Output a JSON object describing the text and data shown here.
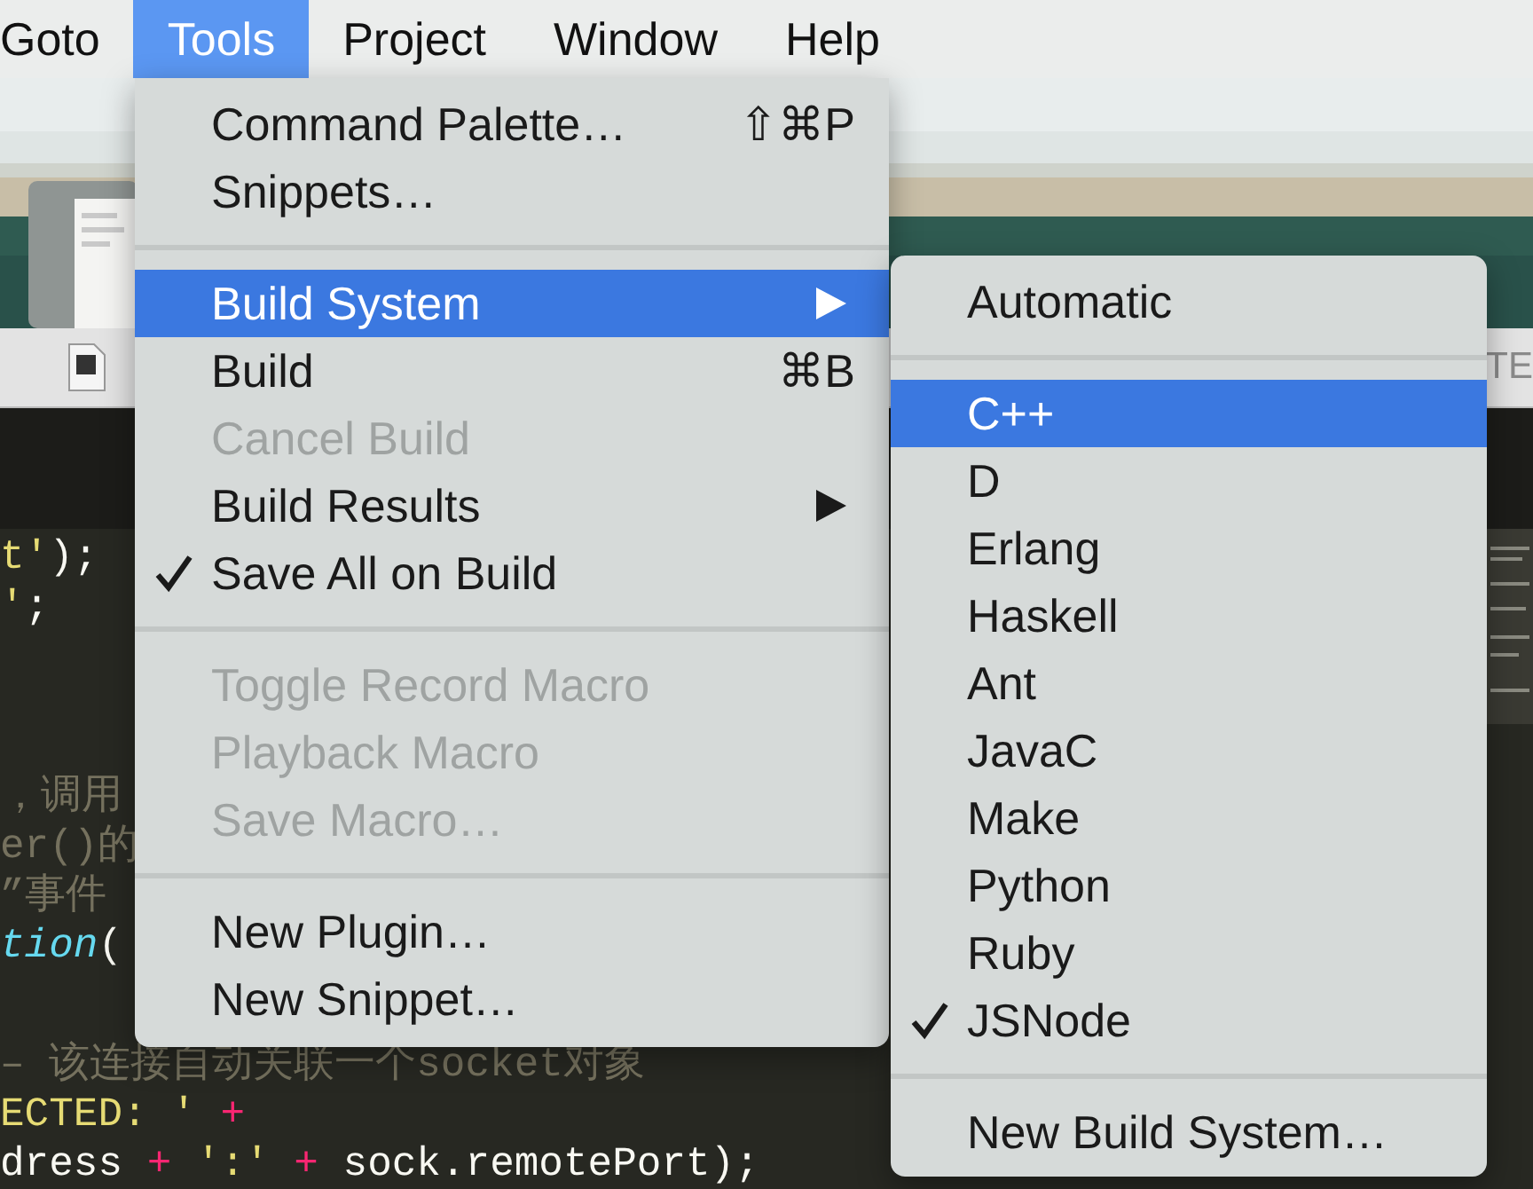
{
  "menu_bar": [
    {
      "label": "Goto",
      "selected": false
    },
    {
      "label": "Tools",
      "selected": true
    },
    {
      "label": "Project",
      "selected": false
    },
    {
      "label": "Window",
      "selected": false
    },
    {
      "label": "Help",
      "selected": false
    }
  ],
  "tab_bar": {
    "tab_text": "TE"
  },
  "editor": {
    "lines": [
      {
        "kind": "code",
        "segments": [
          {
            "kind": "string",
            "text": "t'"
          },
          {
            "kind": "plain",
            "text": ");"
          }
        ]
      },
      {
        "kind": "code",
        "segments": [
          {
            "kind": "string",
            "text": "'"
          },
          {
            "kind": "plain",
            "text": ";"
          }
        ]
      },
      {
        "kind": "blank"
      },
      {
        "kind": "blank"
      },
      {
        "kind": "code",
        "segments": [
          {
            "kind": "comment",
            "text": "，调用"
          }
        ]
      },
      {
        "kind": "code",
        "segments": [
          {
            "kind": "comment",
            "text": "er()的"
          }
        ]
      },
      {
        "kind": "code",
        "segments": [
          {
            "kind": "comment",
            "text": "”事件"
          }
        ]
      },
      {
        "kind": "code",
        "segments": [
          {
            "kind": "func",
            "text": "tion"
          },
          {
            "kind": "plain",
            "text": "("
          }
        ]
      },
      {
        "kind": "blank"
      },
      {
        "kind": "code",
        "segments": [
          {
            "kind": "comment",
            "text": "– 该连接自动关联一个socket对象"
          }
        ]
      },
      {
        "kind": "code",
        "segments": [
          {
            "kind": "string",
            "text": "ECTED: ' "
          },
          {
            "kind": "operator",
            "text": "+"
          }
        ]
      },
      {
        "kind": "code",
        "segments": [
          {
            "kind": "plain",
            "text": "dress "
          },
          {
            "kind": "operator",
            "text": "+ "
          },
          {
            "kind": "string",
            "text": "':' "
          },
          {
            "kind": "operator",
            "text": "+ "
          },
          {
            "kind": "plain",
            "text": "sock.remotePort);"
          }
        ]
      }
    ]
  },
  "tools_menu": {
    "items": [
      {
        "kind": "item",
        "label": "Command Palette…",
        "shortcut": "⇧⌘P",
        "disabled": false,
        "checked": false,
        "selected": false,
        "submenu": false
      },
      {
        "kind": "item",
        "label": "Snippets…",
        "disabled": false,
        "checked": false,
        "selected": false,
        "submenu": false
      },
      {
        "kind": "separator"
      },
      {
        "kind": "item",
        "label": "Build System",
        "disabled": false,
        "checked": false,
        "selected": true,
        "submenu": true
      },
      {
        "kind": "item",
        "label": "Build",
        "shortcut": "⌘B",
        "disabled": false,
        "checked": false,
        "selected": false,
        "submenu": false
      },
      {
        "kind": "item",
        "label": "Cancel Build",
        "disabled": true,
        "checked": false,
        "selected": false,
        "submenu": false
      },
      {
        "kind": "item",
        "label": "Build Results",
        "disabled": false,
        "checked": false,
        "selected": false,
        "submenu": true
      },
      {
        "kind": "item",
        "label": "Save All on Build",
        "disabled": false,
        "checked": true,
        "selected": false,
        "submenu": false
      },
      {
        "kind": "separator"
      },
      {
        "kind": "item",
        "label": "Toggle Record Macro",
        "disabled": true,
        "checked": false,
        "selected": false,
        "submenu": false
      },
      {
        "kind": "item",
        "label": "Playback Macro",
        "disabled": true,
        "checked": false,
        "selected": false,
        "submenu": false
      },
      {
        "kind": "item",
        "label": "Save Macro…",
        "disabled": true,
        "checked": false,
        "selected": false,
        "submenu": false
      },
      {
        "kind": "separator"
      },
      {
        "kind": "item",
        "label": "New Plugin…",
        "disabled": false,
        "checked": false,
        "selected": false,
        "submenu": false
      },
      {
        "kind": "item",
        "label": "New Snippet…",
        "disabled": false,
        "checked": false,
        "selected": false,
        "submenu": false
      }
    ]
  },
  "build_system_menu": {
    "items": [
      {
        "kind": "item",
        "label": "Automatic",
        "checked": false,
        "selected": false
      },
      {
        "kind": "separator"
      },
      {
        "kind": "item",
        "label": "C++",
        "checked": false,
        "selected": true
      },
      {
        "kind": "item",
        "label": "D",
        "checked": false,
        "selected": false
      },
      {
        "kind": "item",
        "label": "Erlang",
        "checked": false,
        "selected": false
      },
      {
        "kind": "item",
        "label": "Haskell",
        "checked": false,
        "selected": false
      },
      {
        "kind": "item",
        "label": "Ant",
        "checked": false,
        "selected": false
      },
      {
        "kind": "item",
        "label": "JavaC",
        "checked": false,
        "selected": false
      },
      {
        "kind": "item",
        "label": "Make",
        "checked": false,
        "selected": false
      },
      {
        "kind": "item",
        "label": "Python",
        "checked": false,
        "selected": false
      },
      {
        "kind": "item",
        "label": "Ruby",
        "checked": false,
        "selected": false
      },
      {
        "kind": "item",
        "label": "JSNode",
        "checked": true,
        "selected": false
      },
      {
        "kind": "separator"
      },
      {
        "kind": "item",
        "label": "New Build System…",
        "checked": false,
        "selected": false
      }
    ]
  }
}
